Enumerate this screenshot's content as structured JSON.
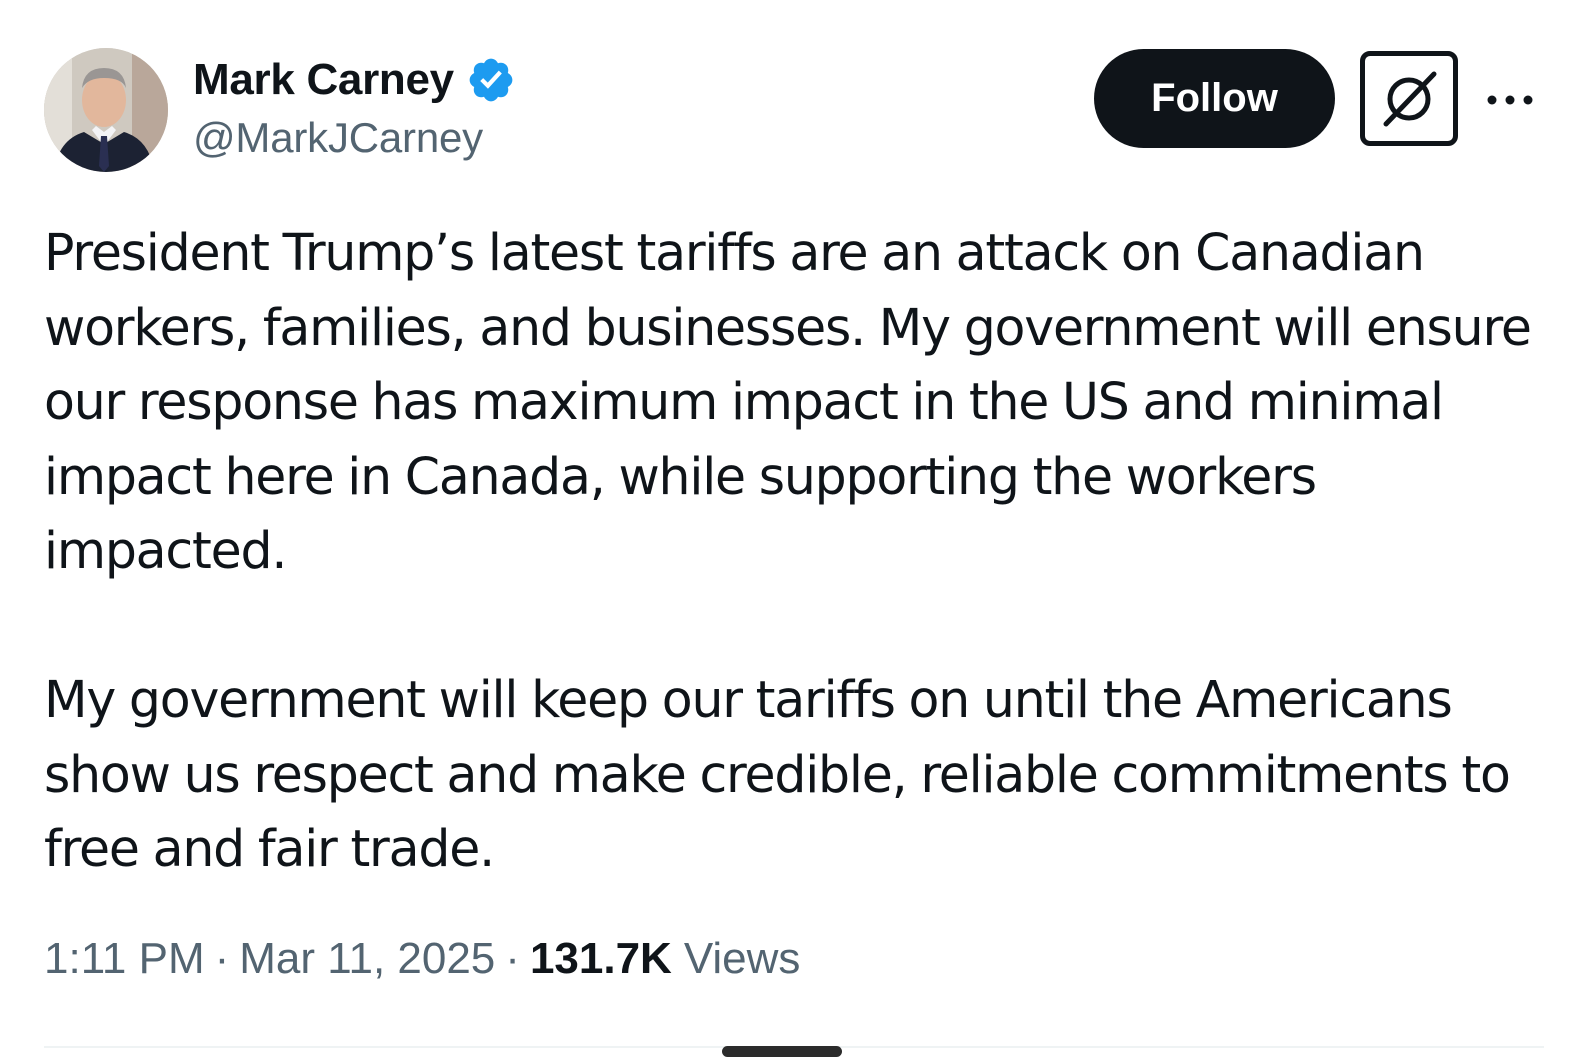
{
  "author": {
    "display_name": "Mark Carney",
    "handle": "@MarkJCarney",
    "verified": true,
    "avatar_icon": "person-portrait"
  },
  "actions": {
    "follow_label": "Follow",
    "grok_icon": "grok-icon",
    "more_icon": "more-horizontal-icon"
  },
  "tweet": {
    "paragraphs": [
      "President Trump’s latest tariffs are an attack on Canadian workers, families, and businesses. My government will ensure our response has maximum impact in the US and minimal impact here in Canada, while supporting the workers impacted.",
      "My government will keep our tariffs on until the Americans show us respect and make credible, reliable commitments to free and fair trade."
    ],
    "time": "1:11 PM",
    "date": "Mar 11, 2025",
    "separator": "·",
    "views_count": "131.7K",
    "views_label": "Views"
  },
  "colors": {
    "text_primary": "#0f1419",
    "text_secondary": "#536471",
    "verified_blue": "#1d9bf0",
    "follow_bg": "#0f1419",
    "background": "#ffffff"
  }
}
